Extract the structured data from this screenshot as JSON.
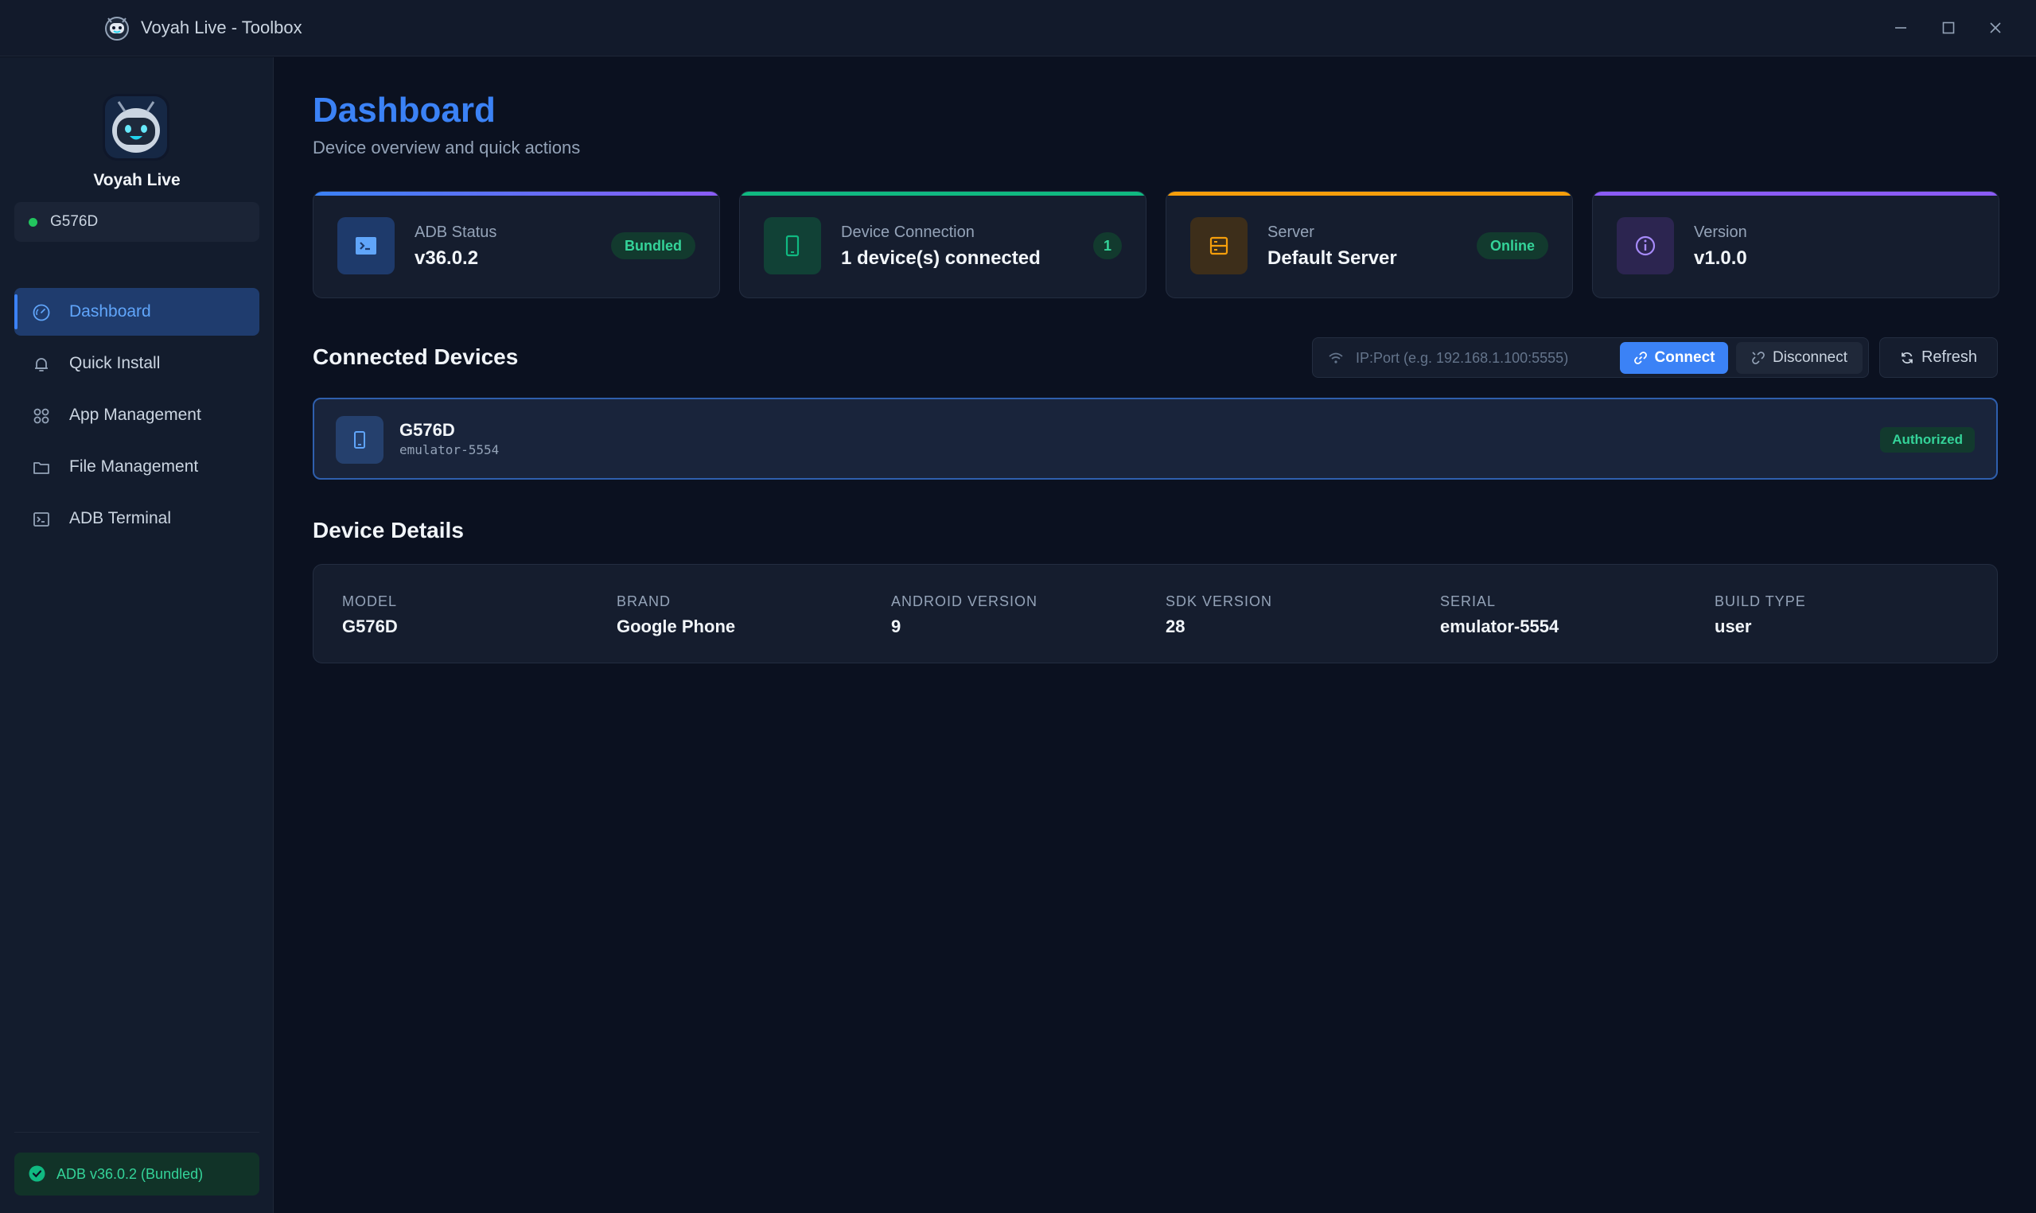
{
  "window": {
    "title": "Voyah Live - Toolbox",
    "controls": {
      "minimize_icon": "minimize-icon",
      "maximize_icon": "maximize-icon",
      "close_icon": "close-icon"
    }
  },
  "sidebar": {
    "brand": {
      "name": "Voyah Live",
      "logo_icon": "robot-logo-icon"
    },
    "device_selector": {
      "label": "G576D",
      "status_color": "#22c55e"
    },
    "items": [
      {
        "label": "Dashboard",
        "icon": "gauge-icon",
        "active": true
      },
      {
        "label": "Quick Install",
        "icon": "bell-icon",
        "active": false
      },
      {
        "label": "App Management",
        "icon": "apps-grid-icon",
        "active": false
      },
      {
        "label": "File Management",
        "icon": "folder-icon",
        "active": false
      },
      {
        "label": "ADB Terminal",
        "icon": "terminal-icon",
        "active": false
      }
    ],
    "footer": {
      "label": "ADB v36.0.2 (Bundled)",
      "icon": "check-circle-icon"
    }
  },
  "header": {
    "title": "Dashboard",
    "subtitle": "Device overview and quick actions"
  },
  "stats": [
    {
      "label": "ADB Status",
      "value": "v36.0.2",
      "badge": "Bundled",
      "accent": "#6366f1",
      "icon": "terminal-icon"
    },
    {
      "label": "Device Connection",
      "value": "1 device(s) connected",
      "badge": "1",
      "accent": "#10b981",
      "icon": "phone-icon"
    },
    {
      "label": "Server",
      "value": "Default Server",
      "badge": "Online",
      "accent": "#f59e0b",
      "icon": "server-icon"
    },
    {
      "label": "Version",
      "value": "v1.0.0",
      "badge": null,
      "accent": "#8b5cf6",
      "icon": "info-icon"
    }
  ],
  "connected_devices": {
    "title": "Connected Devices",
    "input": {
      "placeholder": "IP:Port (e.g. 192.168.1.100:5555)",
      "value": ""
    },
    "connect_label": "Connect",
    "disconnect_label": "Disconnect",
    "refresh_label": "Refresh",
    "devices": [
      {
        "name": "G576D",
        "serial": "emulator-5554",
        "status": "Authorized"
      }
    ]
  },
  "device_details": {
    "title": "Device Details",
    "fields": [
      {
        "key": "MODEL",
        "value": "G576D"
      },
      {
        "key": "BRAND",
        "value": "Google Phone"
      },
      {
        "key": "ANDROID VERSION",
        "value": "9"
      },
      {
        "key": "SDK VERSION",
        "value": "28"
      },
      {
        "key": "SERIAL",
        "value": "emulator-5554"
      },
      {
        "key": "BUILD TYPE",
        "value": "user"
      }
    ]
  },
  "colors": {
    "accent": "#3b82f6",
    "success": "#34d399",
    "background": "#0b1120",
    "panel": "#151d2e"
  }
}
